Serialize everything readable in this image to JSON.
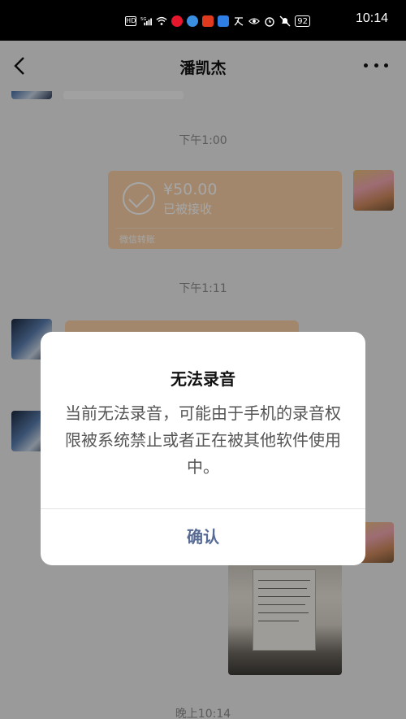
{
  "status_bar": {
    "left_badges": [
      "HD",
      "5G"
    ],
    "battery": "92",
    "time": "10:14"
  },
  "nav": {
    "title": "潘凯杰"
  },
  "chat": {
    "timestamps": [
      "下午1:00",
      "下午1:11",
      "晚上10:14"
    ],
    "transfer": {
      "amount": "¥50.00",
      "status": "已被接收",
      "footer": "微信转账"
    }
  },
  "dialog": {
    "title": "无法录音",
    "message": "当前无法录音，可能由于手机的录音权限被系统禁止或者正在被其他软件使用中。",
    "confirm_label": "确认"
  },
  "colors": {
    "transfer_bubble": "#f9d0a6",
    "dialog_button": "#576b95",
    "background": "#ededed"
  }
}
